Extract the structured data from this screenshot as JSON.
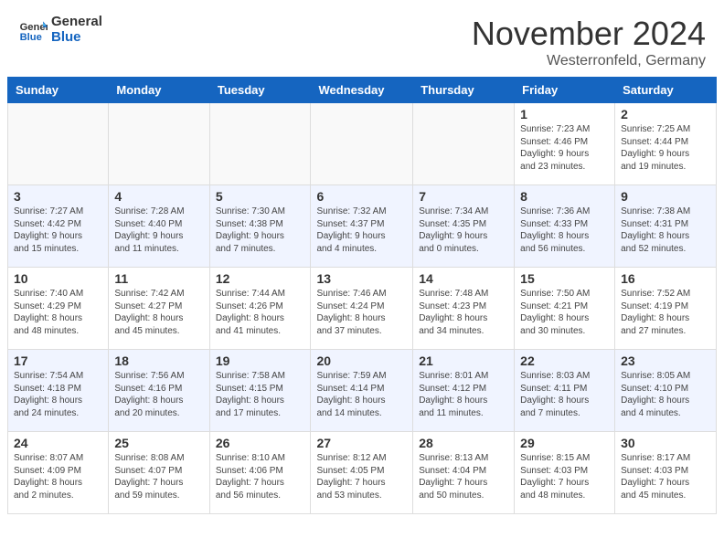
{
  "header": {
    "logo_line1": "General",
    "logo_line2": "Blue",
    "title": "November 2024",
    "subtitle": "Westerronfeld, Germany"
  },
  "days_of_week": [
    "Sunday",
    "Monday",
    "Tuesday",
    "Wednesday",
    "Thursday",
    "Friday",
    "Saturday"
  ],
  "weeks": [
    {
      "days": [
        {
          "number": "",
          "info": ""
        },
        {
          "number": "",
          "info": ""
        },
        {
          "number": "",
          "info": ""
        },
        {
          "number": "",
          "info": ""
        },
        {
          "number": "",
          "info": ""
        },
        {
          "number": "1",
          "info": "Sunrise: 7:23 AM\nSunset: 4:46 PM\nDaylight: 9 hours\nand 23 minutes."
        },
        {
          "number": "2",
          "info": "Sunrise: 7:25 AM\nSunset: 4:44 PM\nDaylight: 9 hours\nand 19 minutes."
        }
      ]
    },
    {
      "days": [
        {
          "number": "3",
          "info": "Sunrise: 7:27 AM\nSunset: 4:42 PM\nDaylight: 9 hours\nand 15 minutes."
        },
        {
          "number": "4",
          "info": "Sunrise: 7:28 AM\nSunset: 4:40 PM\nDaylight: 9 hours\nand 11 minutes."
        },
        {
          "number": "5",
          "info": "Sunrise: 7:30 AM\nSunset: 4:38 PM\nDaylight: 9 hours\nand 7 minutes."
        },
        {
          "number": "6",
          "info": "Sunrise: 7:32 AM\nSunset: 4:37 PM\nDaylight: 9 hours\nand 4 minutes."
        },
        {
          "number": "7",
          "info": "Sunrise: 7:34 AM\nSunset: 4:35 PM\nDaylight: 9 hours\nand 0 minutes."
        },
        {
          "number": "8",
          "info": "Sunrise: 7:36 AM\nSunset: 4:33 PM\nDaylight: 8 hours\nand 56 minutes."
        },
        {
          "number": "9",
          "info": "Sunrise: 7:38 AM\nSunset: 4:31 PM\nDaylight: 8 hours\nand 52 minutes."
        }
      ]
    },
    {
      "days": [
        {
          "number": "10",
          "info": "Sunrise: 7:40 AM\nSunset: 4:29 PM\nDaylight: 8 hours\nand 48 minutes."
        },
        {
          "number": "11",
          "info": "Sunrise: 7:42 AM\nSunset: 4:27 PM\nDaylight: 8 hours\nand 45 minutes."
        },
        {
          "number": "12",
          "info": "Sunrise: 7:44 AM\nSunset: 4:26 PM\nDaylight: 8 hours\nand 41 minutes."
        },
        {
          "number": "13",
          "info": "Sunrise: 7:46 AM\nSunset: 4:24 PM\nDaylight: 8 hours\nand 37 minutes."
        },
        {
          "number": "14",
          "info": "Sunrise: 7:48 AM\nSunset: 4:23 PM\nDaylight: 8 hours\nand 34 minutes."
        },
        {
          "number": "15",
          "info": "Sunrise: 7:50 AM\nSunset: 4:21 PM\nDaylight: 8 hours\nand 30 minutes."
        },
        {
          "number": "16",
          "info": "Sunrise: 7:52 AM\nSunset: 4:19 PM\nDaylight: 8 hours\nand 27 minutes."
        }
      ]
    },
    {
      "days": [
        {
          "number": "17",
          "info": "Sunrise: 7:54 AM\nSunset: 4:18 PM\nDaylight: 8 hours\nand 24 minutes."
        },
        {
          "number": "18",
          "info": "Sunrise: 7:56 AM\nSunset: 4:16 PM\nDaylight: 8 hours\nand 20 minutes."
        },
        {
          "number": "19",
          "info": "Sunrise: 7:58 AM\nSunset: 4:15 PM\nDaylight: 8 hours\nand 17 minutes."
        },
        {
          "number": "20",
          "info": "Sunrise: 7:59 AM\nSunset: 4:14 PM\nDaylight: 8 hours\nand 14 minutes."
        },
        {
          "number": "21",
          "info": "Sunrise: 8:01 AM\nSunset: 4:12 PM\nDaylight: 8 hours\nand 11 minutes."
        },
        {
          "number": "22",
          "info": "Sunrise: 8:03 AM\nSunset: 4:11 PM\nDaylight: 8 hours\nand 7 minutes."
        },
        {
          "number": "23",
          "info": "Sunrise: 8:05 AM\nSunset: 4:10 PM\nDaylight: 8 hours\nand 4 minutes."
        }
      ]
    },
    {
      "days": [
        {
          "number": "24",
          "info": "Sunrise: 8:07 AM\nSunset: 4:09 PM\nDaylight: 8 hours\nand 2 minutes."
        },
        {
          "number": "25",
          "info": "Sunrise: 8:08 AM\nSunset: 4:07 PM\nDaylight: 7 hours\nand 59 minutes."
        },
        {
          "number": "26",
          "info": "Sunrise: 8:10 AM\nSunset: 4:06 PM\nDaylight: 7 hours\nand 56 minutes."
        },
        {
          "number": "27",
          "info": "Sunrise: 8:12 AM\nSunset: 4:05 PM\nDaylight: 7 hours\nand 53 minutes."
        },
        {
          "number": "28",
          "info": "Sunrise: 8:13 AM\nSunset: 4:04 PM\nDaylight: 7 hours\nand 50 minutes."
        },
        {
          "number": "29",
          "info": "Sunrise: 8:15 AM\nSunset: 4:03 PM\nDaylight: 7 hours\nand 48 minutes."
        },
        {
          "number": "30",
          "info": "Sunrise: 8:17 AM\nSunset: 4:03 PM\nDaylight: 7 hours\nand 45 minutes."
        }
      ]
    }
  ]
}
